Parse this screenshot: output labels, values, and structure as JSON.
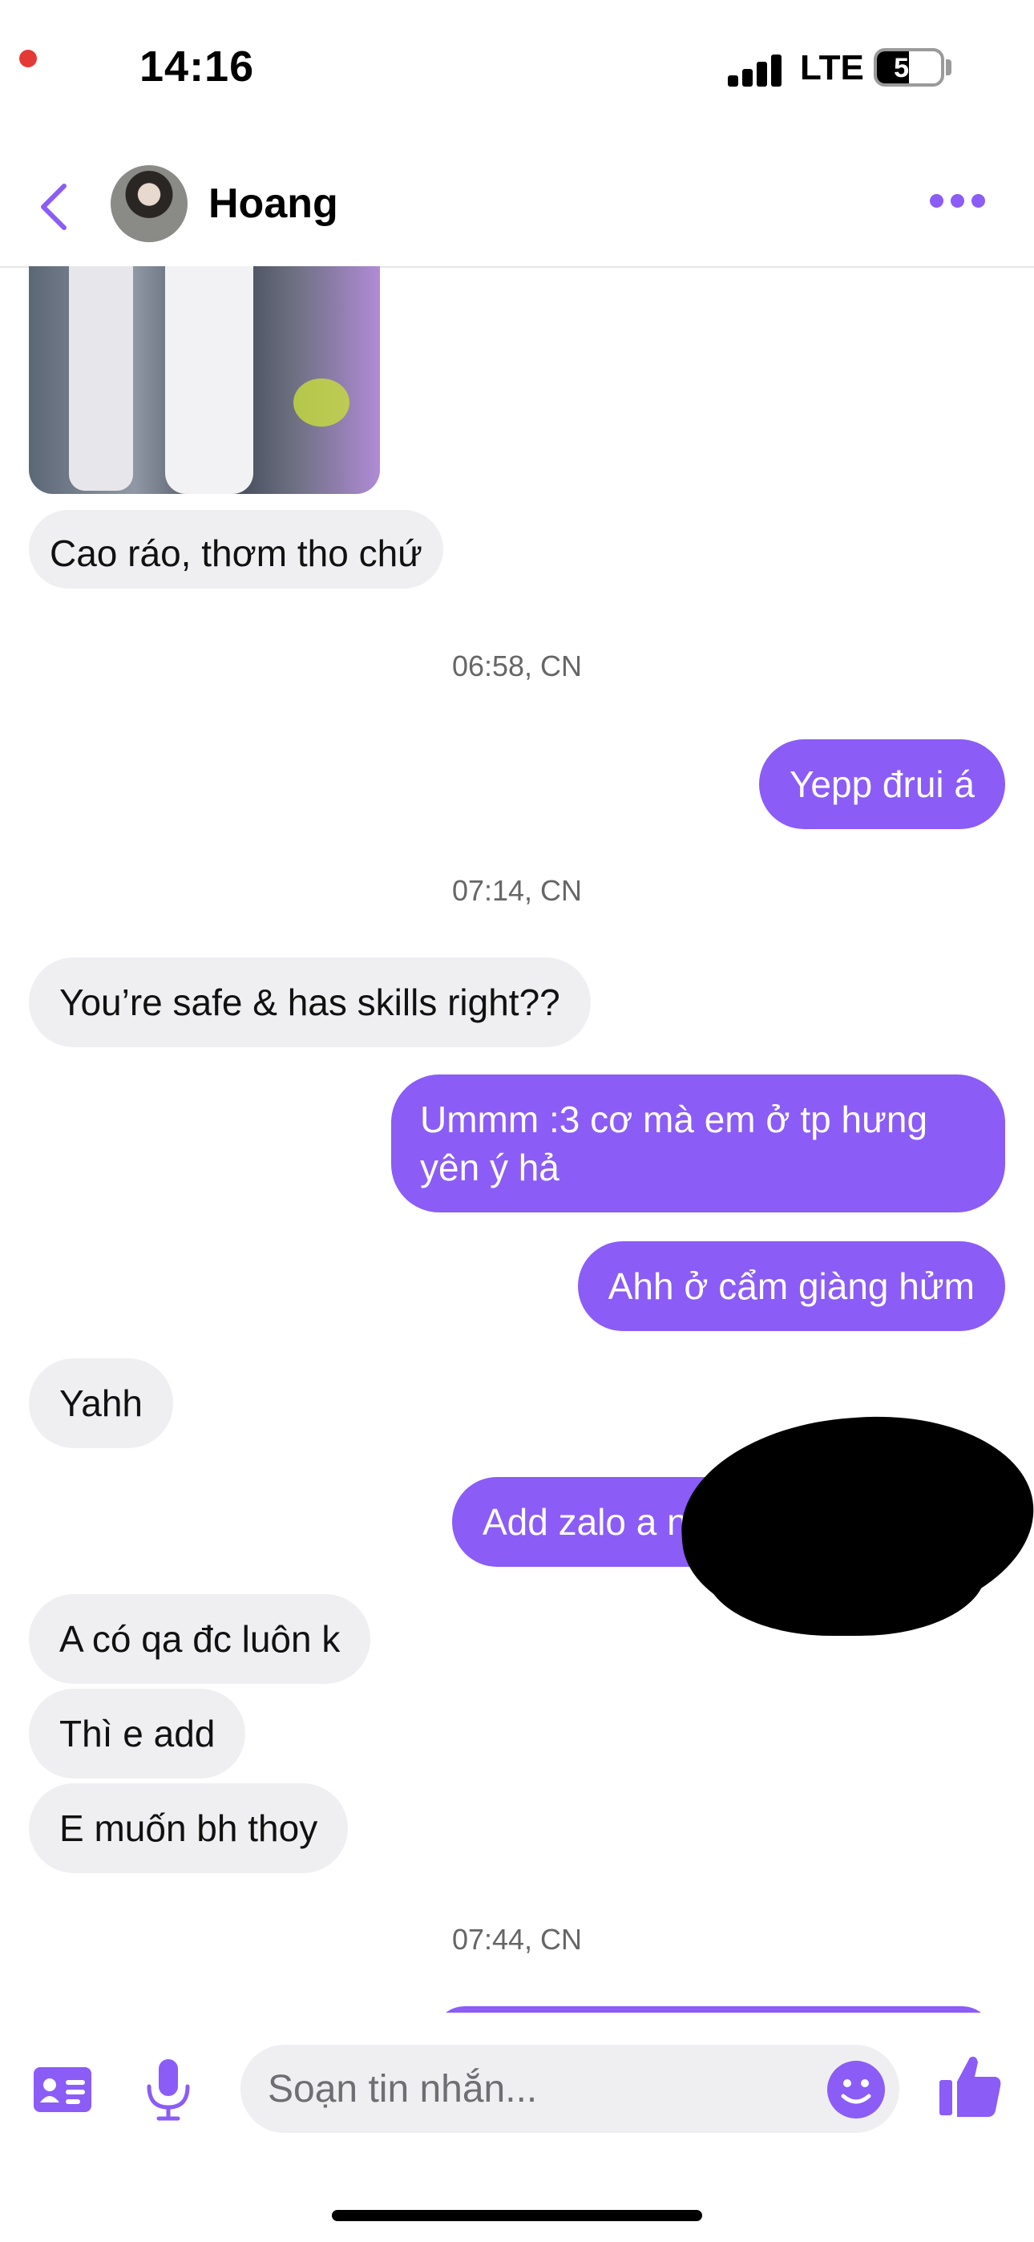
{
  "status_bar": {
    "time": "14:16",
    "network": "LTE",
    "battery_percent": "50",
    "battery_level": 0.5
  },
  "header": {
    "contact_name": "Hoang"
  },
  "colors": {
    "accent": "#8b5cf6",
    "incoming_bubble": "#efeff1",
    "record_dot": "#e53935"
  },
  "messages": [
    {
      "dir": "in",
      "text": "Cao ráo, thơm tho chứ"
    },
    {
      "stamp": "06:58, CN"
    },
    {
      "dir": "out",
      "text": "Yepp đrui á"
    },
    {
      "stamp": "07:14, CN"
    },
    {
      "dir": "in",
      "text": "You’re safe & has skills right??"
    },
    {
      "dir": "out",
      "text": "Ummm :3 cơ mà em ở tp hưng yên ý hả"
    },
    {
      "dir": "out",
      "text": "Ahh ở cẩm giàng hửm"
    },
    {
      "dir": "in",
      "text": "Yahh"
    },
    {
      "dir": "out",
      "text": "Add zalo a n"
    },
    {
      "dir": "in",
      "text": "A có qa đc luôn k"
    },
    {
      "dir": "in",
      "text": "Thì e add"
    },
    {
      "dir": "in",
      "text": "E muốn bh thoy"
    },
    {
      "stamp": "07:44, CN"
    }
  ],
  "composer": {
    "placeholder": "Soạn tin nhắn..."
  },
  "icons": {
    "back": "chevron-left-icon",
    "more": "more-dots-icon",
    "contact_card": "contact-card-icon",
    "mic": "microphone-icon",
    "emoji": "emoji-icon",
    "like": "thumbs-up-icon"
  }
}
